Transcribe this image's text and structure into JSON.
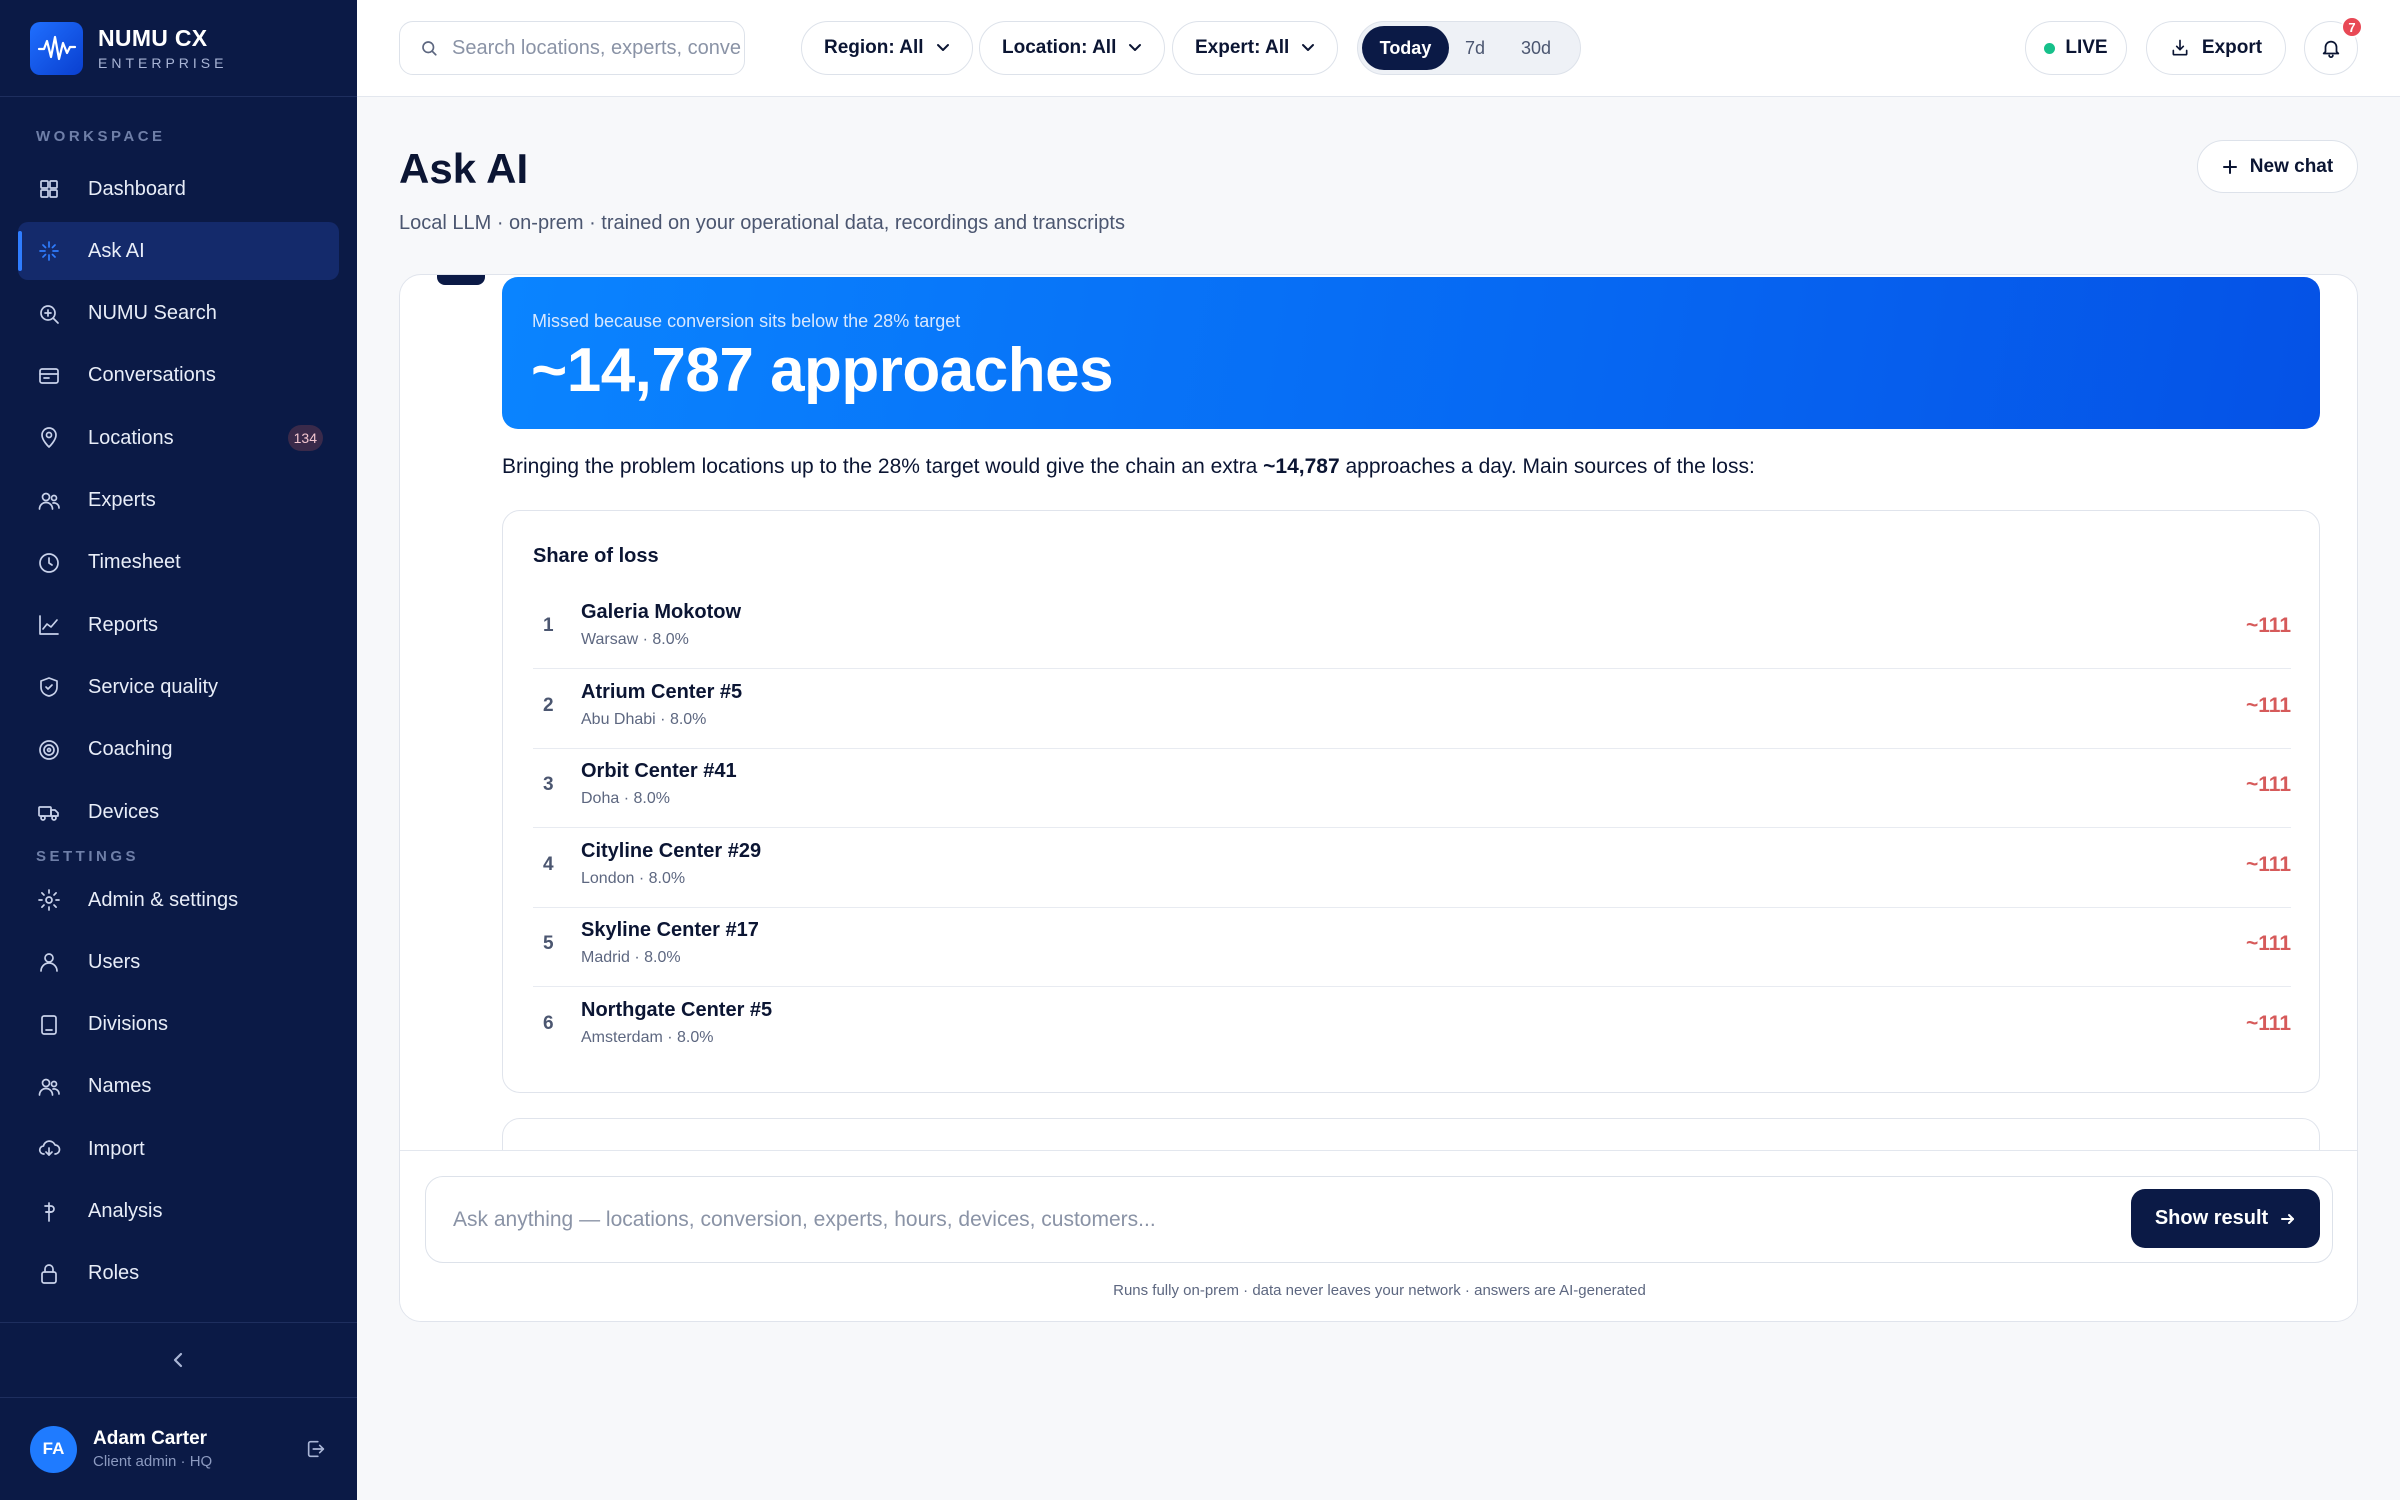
{
  "brand": {
    "name": "NUMU CX",
    "sub": "ENTERPRISE"
  },
  "sidebar": {
    "workspace_label": "WORKSPACE",
    "settings_label": "SETTINGS",
    "workspace_items": [
      {
        "label": "Dashboard",
        "icon": "grid-icon"
      },
      {
        "label": "Ask AI",
        "icon": "sparkle-icon",
        "active": true
      },
      {
        "label": "NUMU Search",
        "icon": "search-zoom-icon"
      },
      {
        "label": "Conversations",
        "icon": "inbox-icon"
      },
      {
        "label": "Locations",
        "icon": "map-pin-icon",
        "badge": "134"
      },
      {
        "label": "Experts",
        "icon": "users-icon"
      },
      {
        "label": "Timesheet",
        "icon": "clock-icon"
      },
      {
        "label": "Reports",
        "icon": "chart-icon"
      },
      {
        "label": "Service quality",
        "icon": "shield-icon"
      },
      {
        "label": "Coaching",
        "icon": "target-icon"
      },
      {
        "label": "Devices",
        "icon": "truck-icon"
      }
    ],
    "settings_items": [
      {
        "label": "Admin & settings",
        "icon": "gear-icon"
      },
      {
        "label": "Users",
        "icon": "user-icon"
      },
      {
        "label": "Divisions",
        "icon": "building-icon"
      },
      {
        "label": "Names",
        "icon": "users-icon"
      },
      {
        "label": "Import",
        "icon": "cloud-download-icon"
      },
      {
        "label": "Analysis",
        "icon": "analysis-icon"
      },
      {
        "label": "Roles",
        "icon": "lock-icon"
      }
    ],
    "user": {
      "initials": "FA",
      "name": "Adam Carter",
      "role": "Client admin · HQ"
    }
  },
  "topbar": {
    "search_placeholder": "Search locations, experts, conversations",
    "region": "Region: All",
    "location": "Location: All",
    "expert": "Expert: All",
    "ranges": [
      "Today",
      "7d",
      "30d"
    ],
    "active_range": "Today",
    "live": "LIVE",
    "export": "Export",
    "notifications": "7"
  },
  "page": {
    "title": "Ask AI",
    "subtitle": "Local LLM · on-prem · trained on your operational data, recordings and transcripts",
    "new_chat": "New chat"
  },
  "answer": {
    "hero_sub": "Missed because conversion sits below the 28% target",
    "hero_value": "~14,787 approaches",
    "summary_pre": "Bringing the problem locations up to the 28% target would give the chain an extra ",
    "summary_bold": "~14,787",
    "summary_post": " approaches a day. Main sources of the loss:",
    "loss_title": "Share of loss",
    "rows": [
      {
        "rank": "1",
        "name": "Galeria Mokotow",
        "meta": "Warsaw · 8.0%",
        "value": "~111"
      },
      {
        "rank": "2",
        "name": "Atrium Center #5",
        "meta": "Abu Dhabi · 8.0%",
        "value": "~111"
      },
      {
        "rank": "3",
        "name": "Orbit Center #41",
        "meta": "Doha · 8.0%",
        "value": "~111"
      },
      {
        "rank": "4",
        "name": "Cityline Center #29",
        "meta": "London · 8.0%",
        "value": "~111"
      },
      {
        "rank": "5",
        "name": "Skyline Center #17",
        "meta": "Madrid · 8.0%",
        "value": "~111"
      },
      {
        "rank": "6",
        "name": "Northgate Center #5",
        "meta": "Amsterdam · 8.0%",
        "value": "~111"
      }
    ]
  },
  "composer": {
    "placeholder": "Ask anything — locations, conversion, experts, hours, devices, customers...",
    "submit": "Show result",
    "disclaimer": "Runs fully on-prem · data never leaves your network · answers are AI-generated"
  }
}
